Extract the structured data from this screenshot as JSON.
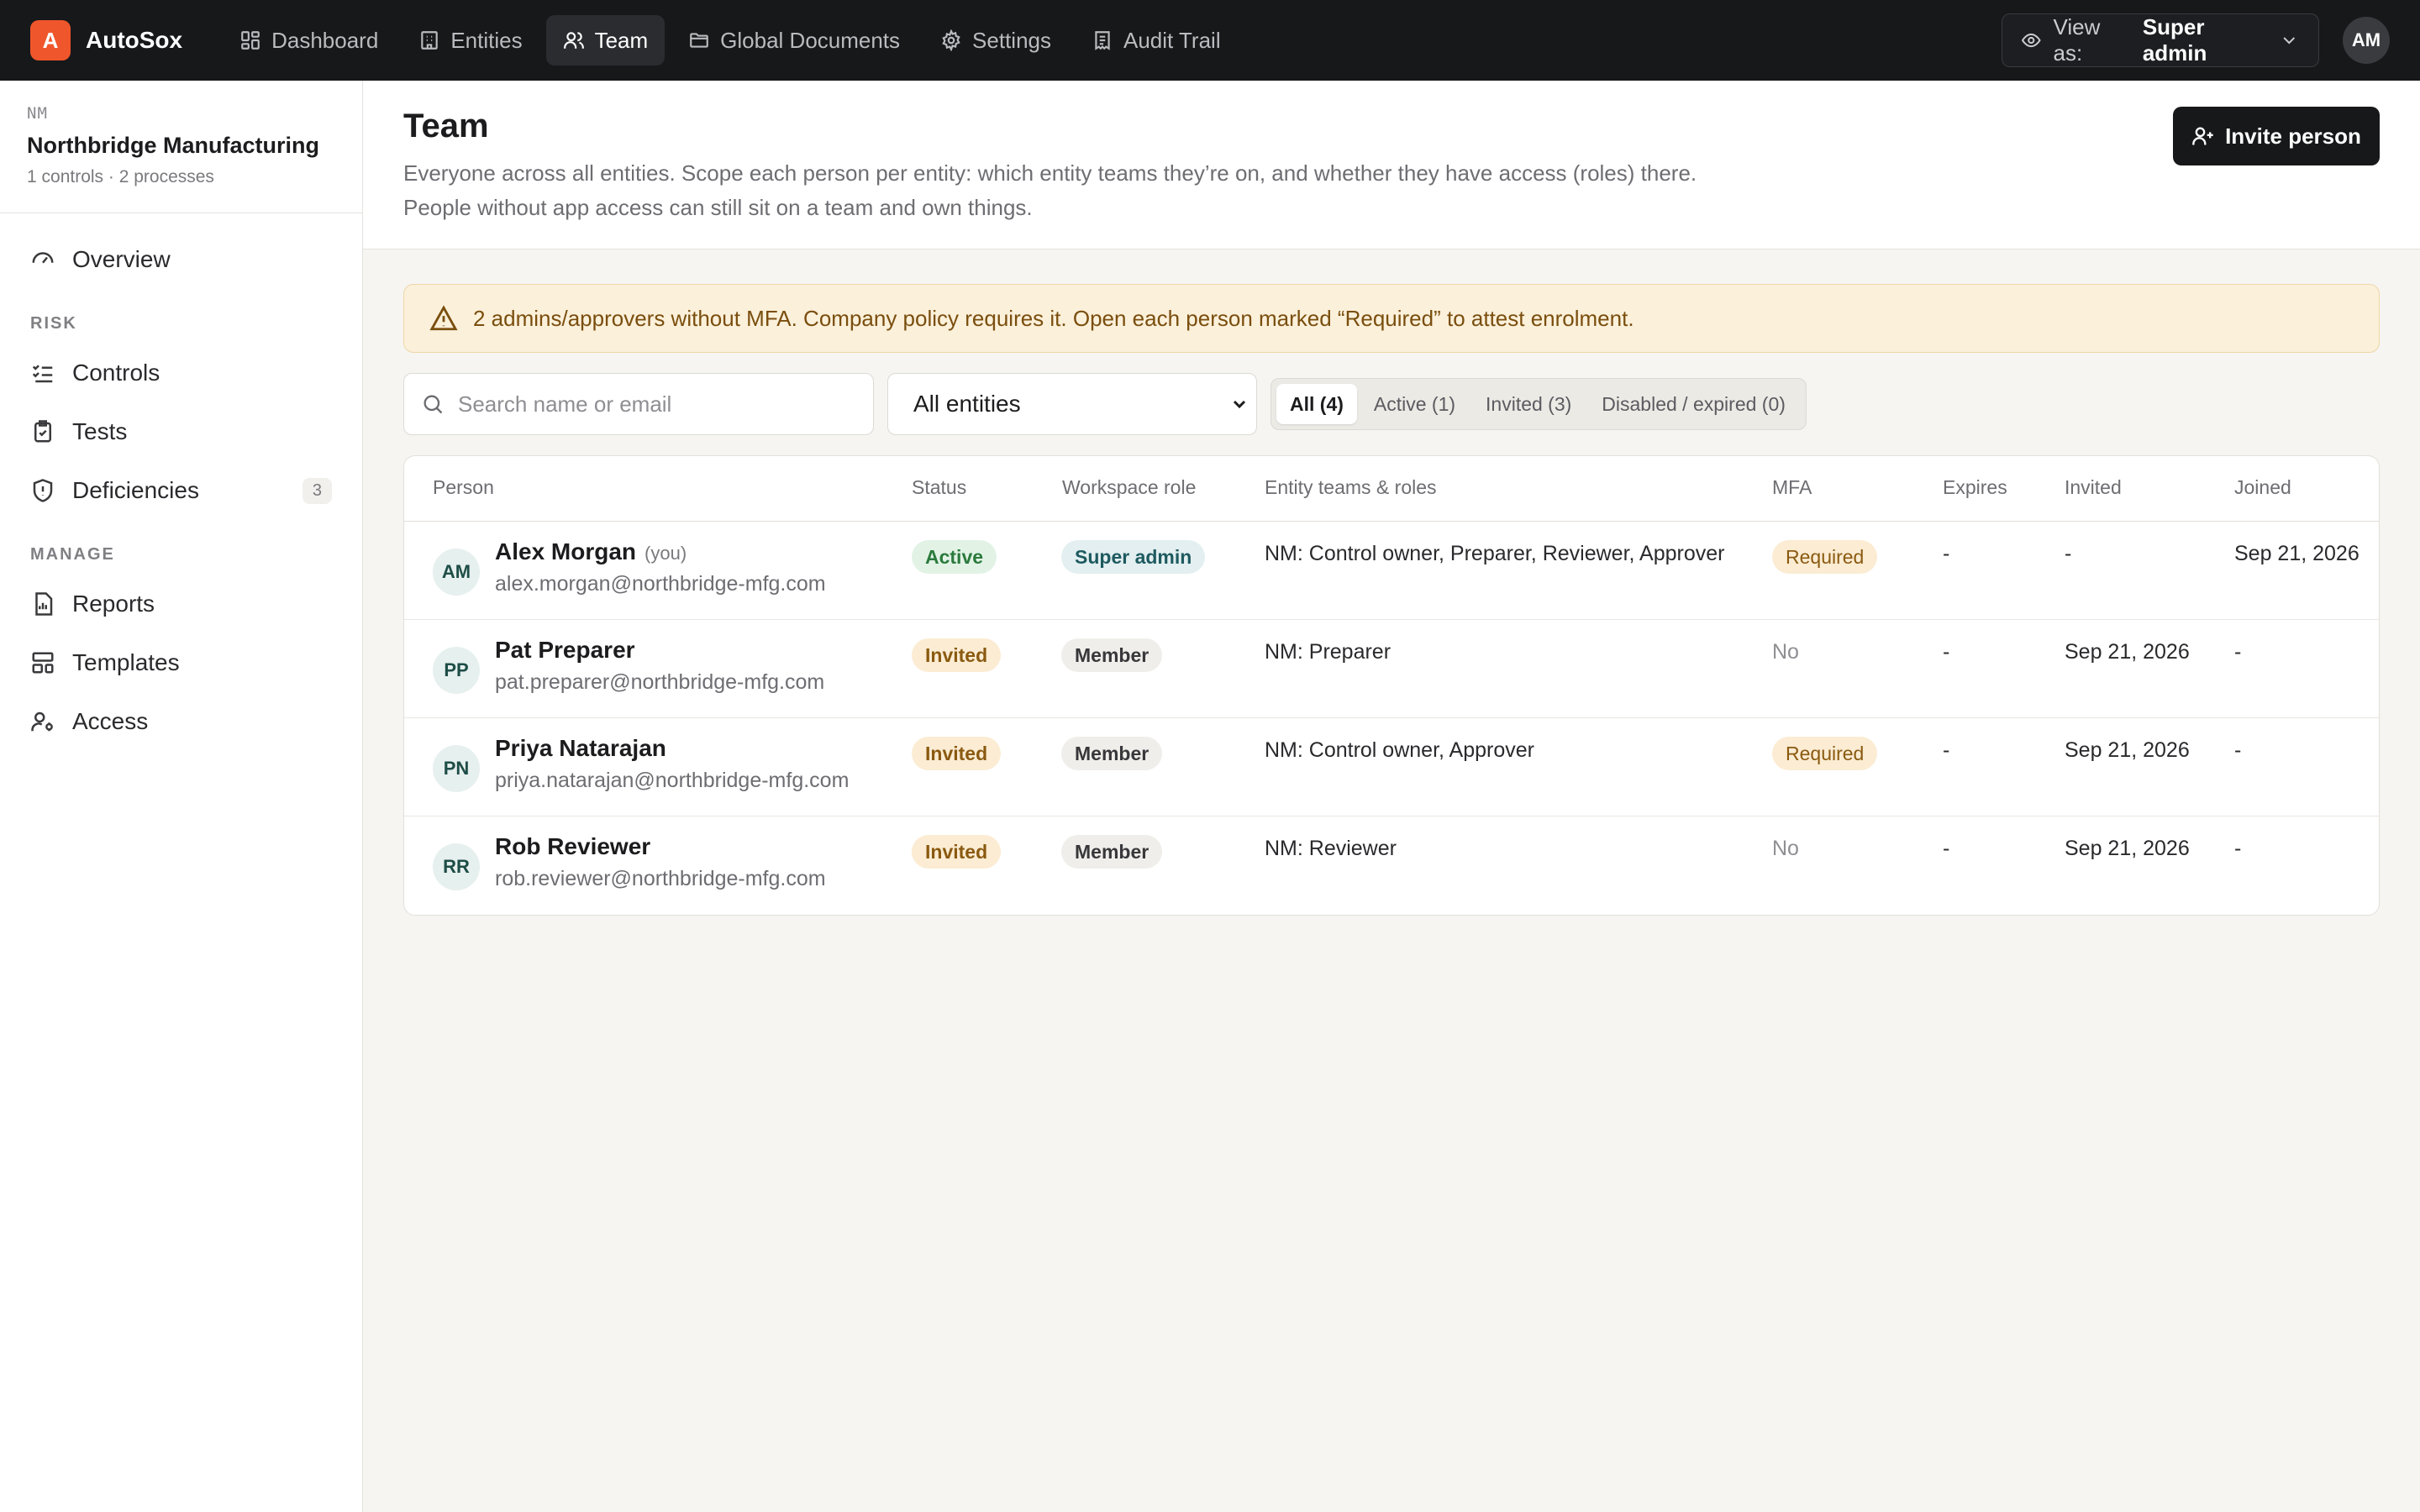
{
  "app": {
    "logo_letter": "A",
    "name": "AutoSox"
  },
  "nav": [
    {
      "label": "Dashboard",
      "icon": "grid-icon"
    },
    {
      "label": "Entities",
      "icon": "building-icon"
    },
    {
      "label": "Team",
      "icon": "users-icon",
      "active": true
    },
    {
      "label": "Global Documents",
      "icon": "folder-icon"
    },
    {
      "label": "Settings",
      "icon": "gear-icon"
    },
    {
      "label": "Audit Trail",
      "icon": "receipt-icon"
    }
  ],
  "view_as": {
    "label": "View as:",
    "value": "Super admin"
  },
  "user_avatar": "AM",
  "sidebar": {
    "org_code": "NM",
    "org_name": "Northbridge Manufacturing",
    "org_meta": "1 controls · 2 processes",
    "overview": "Overview",
    "risk_section": "RISK",
    "risk_items": [
      "Controls",
      "Tests",
      "Deficiencies"
    ],
    "deficiencies_count": "3",
    "manage_section": "MANAGE",
    "manage_items": [
      "Reports",
      "Templates",
      "Access"
    ]
  },
  "page": {
    "title": "Team",
    "description": "Everyone across all entities. Scope each person per entity: which entity teams they’re on, and whether they have access (roles) there. People without app access can still sit on a team and own things.",
    "invite_button": "Invite person"
  },
  "alert": {
    "text": "2 admins/approvers without MFA. Company policy requires it. Open each person marked “Required” to attest enrolment."
  },
  "filters": {
    "search_placeholder": "Search name or email",
    "entity_select": "All entities",
    "segments": [
      "All (4)",
      "Active (1)",
      "Invited (3)",
      "Disabled / expired (0)"
    ]
  },
  "table": {
    "headers": [
      "Person",
      "Status",
      "Workspace role",
      "Entity teams & roles",
      "MFA",
      "Expires",
      "Invited",
      "Joined"
    ],
    "rows": [
      {
        "initials": "AM",
        "name": "Alex Morgan",
        "you": "(you)",
        "email": "alex.morgan@northbridge-mfg.com",
        "status": "Active",
        "role": "Super admin",
        "teams": "NM: Control owner, Preparer, Reviewer, Approver",
        "mfa": "Required",
        "expires": "-",
        "invited": "-",
        "joined": "Sep 21, 2026"
      },
      {
        "initials": "PP",
        "name": "Pat Preparer",
        "you": "",
        "email": "pat.preparer@northbridge-mfg.com",
        "status": "Invited",
        "role": "Member",
        "teams": "NM: Preparer",
        "mfa": "No",
        "expires": "-",
        "invited": "Sep 21, 2026",
        "joined": "-"
      },
      {
        "initials": "PN",
        "name": "Priya Natarajan",
        "you": "",
        "email": "priya.natarajan@northbridge-mfg.com",
        "status": "Invited",
        "role": "Member",
        "teams": "NM: Control owner, Approver",
        "mfa": "Required",
        "expires": "-",
        "invited": "Sep 21, 2026",
        "joined": "-"
      },
      {
        "initials": "RR",
        "name": "Rob Reviewer",
        "you": "",
        "email": "rob.reviewer@northbridge-mfg.com",
        "status": "Invited",
        "role": "Member",
        "teams": "NM: Reviewer",
        "mfa": "No",
        "expires": "-",
        "invited": "Sep 21, 2026",
        "joined": "-"
      }
    ]
  },
  "colors": {
    "accent": "#f0562b",
    "topbar": "#17181a",
    "background": "#f6f5f2"
  }
}
